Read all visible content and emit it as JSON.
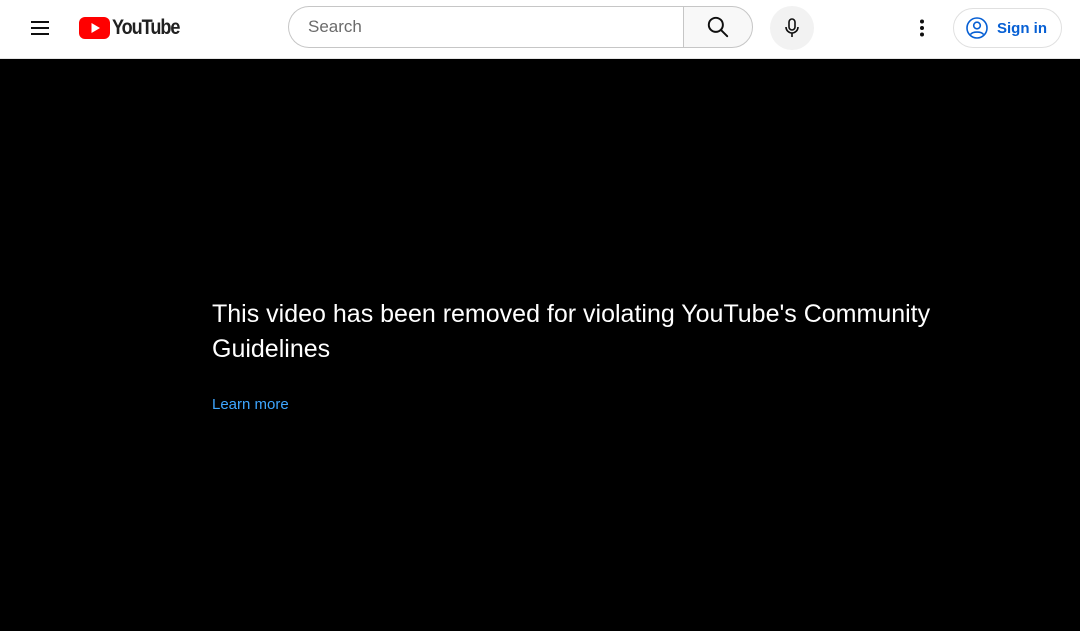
{
  "header": {
    "logo_text": "YouTube",
    "search": {
      "placeholder": "Search",
      "value": ""
    },
    "signin_label": "Sign in",
    "colors": {
      "brand_red": "#ff0000",
      "link_blue": "#065fd4"
    },
    "icons": [
      "menu-icon",
      "youtube-logo-icon",
      "search-icon",
      "microphone-icon",
      "more-vert-icon",
      "account-circle-icon"
    ]
  },
  "player": {
    "error_message": "This video has been removed for violating YouTube's Community Guidelines",
    "learn_more_label": "Learn more",
    "colors": {
      "text": "#ffffff",
      "link": "#3ea6ff",
      "background": "#000000"
    }
  }
}
